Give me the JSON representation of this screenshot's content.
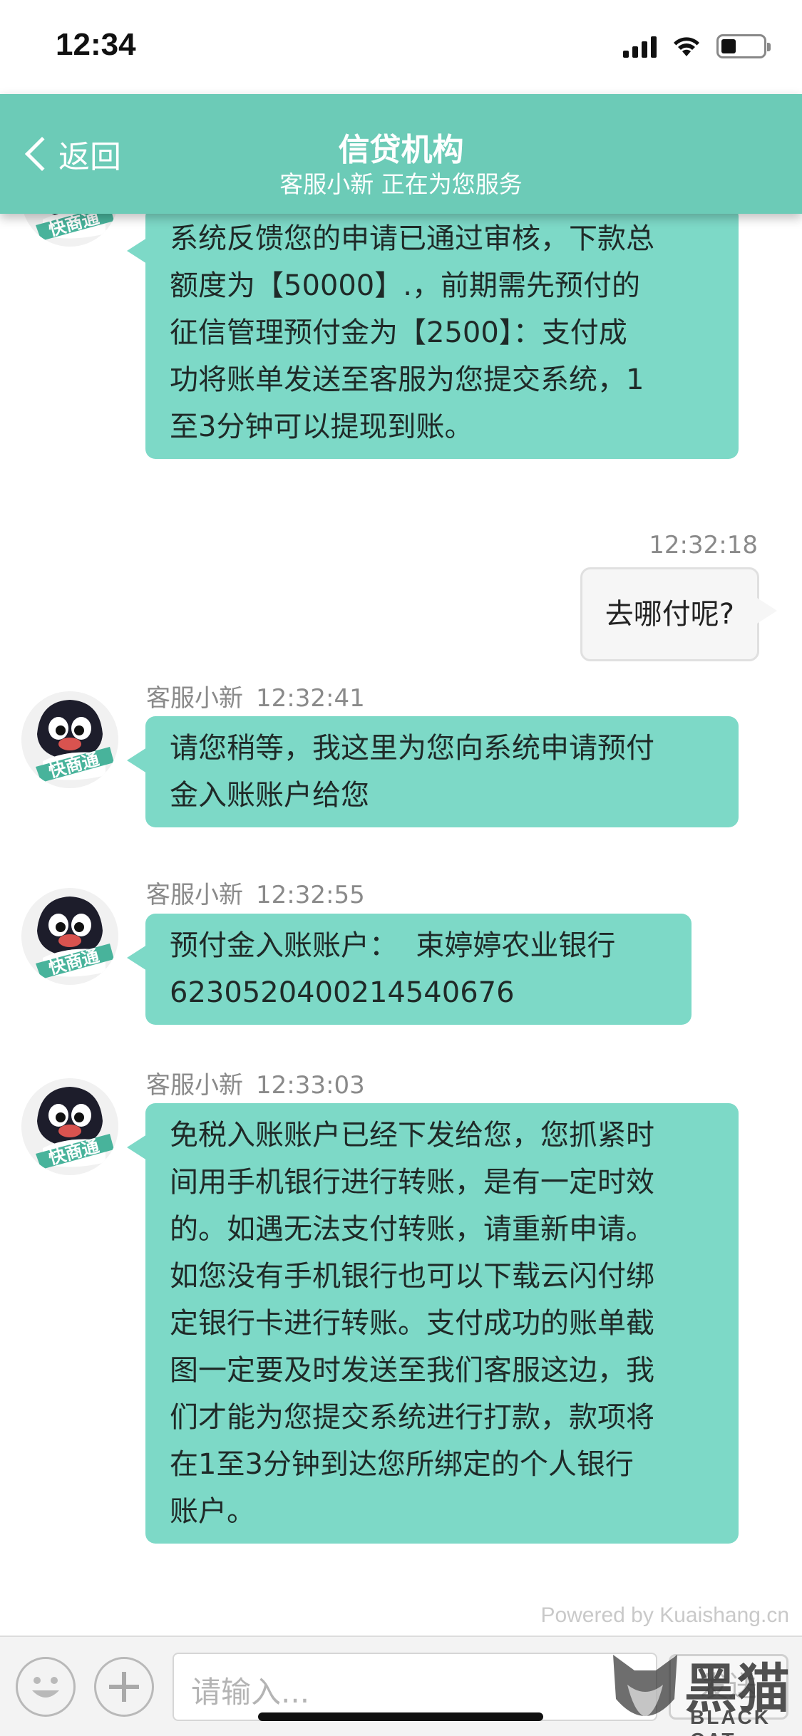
{
  "status_bar": {
    "time": "12:34",
    "battery_level": 0.35
  },
  "nav": {
    "back_label": "返回",
    "title": "信贷机构",
    "subtitle": "客服小新 正在为您服务"
  },
  "messages": [
    {
      "direction": "incoming",
      "sender": "",
      "time": "",
      "text": "系统反馈您的申请已通过审核，下款总额度为【50000】.，前期需先预付的征信管理预付金为【2500】：支付成功将账单发送至客服为您提交系统，1至3分钟可以提现到账。",
      "lines": [
        "系统反馈您的申请已通过审核，下款总",
        "额度为【50000】.，前期需先预付的",
        "征信管理预付金为【2500】：支付成",
        "功将账单发送至客服为您提交系统，1",
        "至3分钟可以提现到账。"
      ]
    },
    {
      "direction": "outgoing",
      "time": "12:32:18",
      "text": "去哪付呢?"
    },
    {
      "direction": "incoming",
      "sender": "客服小新",
      "time": "12:32:41",
      "text": "请您稍等，我这里为您向系统申请预付金入账账户给您",
      "lines": [
        "请您稍等，我这里为您向系统申请预付",
        "金入账账户给您"
      ]
    },
    {
      "direction": "incoming",
      "sender": "客服小新",
      "time": "12:32:55",
      "text": "预付金入账账户： 束婷婷农业银行6230520400214540676",
      "lines": [
        "预付金入账账户：  束婷婷农业银行",
        "6230520400214540676"
      ]
    },
    {
      "direction": "incoming",
      "sender": "客服小新",
      "time": "12:33:03",
      "text": "免税入账账户已经下发给您，您抓紧时间用手机银行进行转账，是有一定时效的。如遇无法支付转账，请重新申请。如您没有手机银行也可以下载云闪付绑定银行卡进行转账。支付成功的账单截图一定要及时发送至我们客服这边，我们才能为您提交系统进行打款，款项将在1至3分钟到达您所绑定的个人银行账户。",
      "lines": [
        "免税入账账户已经下发给您，您抓紧时",
        "间用手机银行进行转账，是有一定时效",
        "的。如遇无法支付转账，请重新申请。",
        "如您没有手机银行也可以下载云闪付绑",
        "定银行卡进行转账。支付成功的账单截",
        "图一定要及时发送至我们客服这边，我",
        "们才能为您提交系统进行打款，款项将",
        "在1至3分钟到达您所绑定的个人银行",
        "账户。"
      ]
    }
  ],
  "avatar_badge": "快商通",
  "powered_by": "Powered by Kuaishang.cn",
  "input": {
    "placeholder": "请输入...",
    "send_label": "发送"
  },
  "watermark": {
    "word": "黑猫",
    "sub": "BLACK CAT"
  },
  "colors": {
    "accent": "#6ccbb7",
    "incoming_bubble": "#7dd9c7",
    "outgoing_bubble": "#f6f6f6"
  }
}
